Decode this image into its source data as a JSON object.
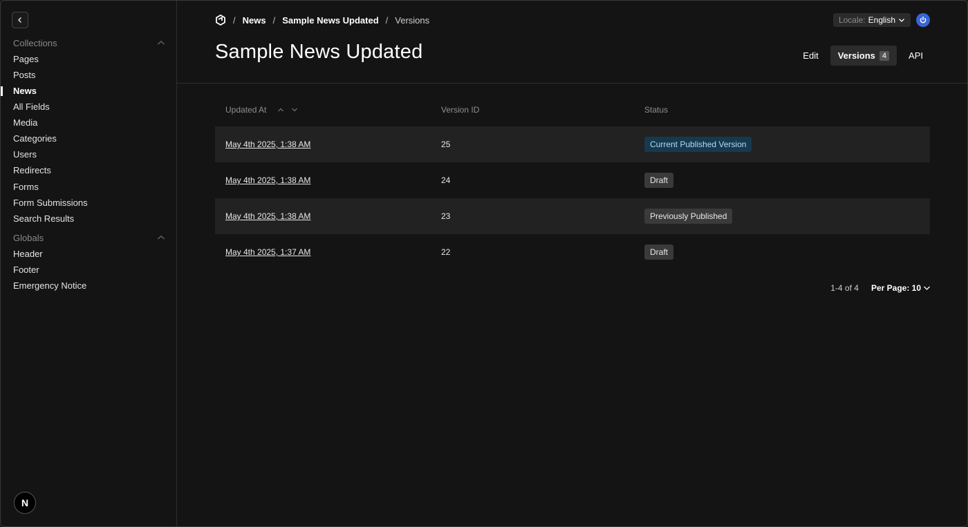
{
  "sidebar": {
    "collections_label": "Collections",
    "collections": [
      {
        "label": "Pages"
      },
      {
        "label": "Posts"
      },
      {
        "label": "News"
      },
      {
        "label": "All Fields"
      },
      {
        "label": "Media"
      },
      {
        "label": "Categories"
      },
      {
        "label": "Users"
      },
      {
        "label": "Redirects"
      },
      {
        "label": "Forms"
      },
      {
        "label": "Form Submissions"
      },
      {
        "label": "Search Results"
      }
    ],
    "active_item": "News",
    "globals_label": "Globals",
    "globals": [
      {
        "label": "Header"
      },
      {
        "label": "Footer"
      },
      {
        "label": "Emergency Notice"
      }
    ],
    "badge_letter": "N"
  },
  "breadcrumb": {
    "sep": "/",
    "items": [
      "News",
      "Sample News Updated",
      "Versions"
    ]
  },
  "locale": {
    "label": "Locale:",
    "value": "English"
  },
  "page_title": "Sample News Updated",
  "tabs": {
    "edit": "Edit",
    "versions": "Versions",
    "versions_count": "4",
    "api": "API"
  },
  "table": {
    "headers": [
      "Updated At",
      "Version ID",
      "Status"
    ],
    "rows": [
      {
        "updated_at": "May 4th 2025, 1:38 AM",
        "version_id": "25",
        "status": "Current Published Version"
      },
      {
        "updated_at": "May 4th 2025, 1:38 AM",
        "version_id": "24",
        "status": "Draft"
      },
      {
        "updated_at": "May 4th 2025, 1:38 AM",
        "version_id": "23",
        "status": "Previously Published"
      },
      {
        "updated_at": "May 4th 2025, 1:37 AM",
        "version_id": "22",
        "status": "Draft"
      }
    ]
  },
  "pagination": {
    "range": "1-4 of 4",
    "per_page": "Per Page: 10"
  },
  "colors": {
    "accent": "#3a64d8",
    "current_pill_bg": "#153a50",
    "current_pill_text": "#b7d9ee"
  }
}
